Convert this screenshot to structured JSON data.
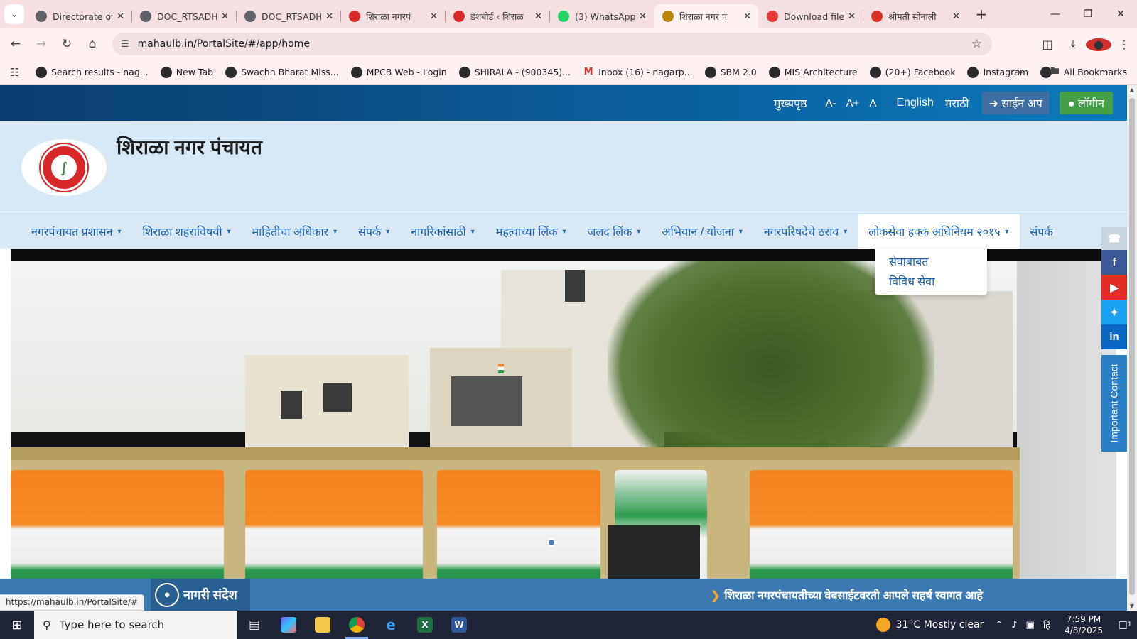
{
  "browser": {
    "tabs": [
      {
        "title": "Directorate of",
        "favicon_color": "#5f6368"
      },
      {
        "title": "DOC_RTSADHI",
        "favicon_color": "#5f6368"
      },
      {
        "title": "DOC_RTSADHI",
        "favicon_color": "#5f6368"
      },
      {
        "title": "शिराळा नगरपं",
        "favicon_color": "#d62828"
      },
      {
        "title": "डॅशबोर्ड ‹ शिराळ",
        "favicon_color": "#d62828"
      },
      {
        "title": "(3) WhatsApp",
        "favicon_color": "#25d366"
      },
      {
        "title": "शिराळा नगर पं",
        "favicon_color": "#b8860b"
      },
      {
        "title": "Download file",
        "favicon_color": "#e53935"
      },
      {
        "title": "श्रीमती सोनाली",
        "favicon_color": "#d93025"
      }
    ],
    "active_tab_index": 6,
    "url": "mahaulb.in/PortalSite/#/app/home",
    "bookmarks": [
      {
        "label": "Search results - nag..."
      },
      {
        "label": "New Tab"
      },
      {
        "label": "Swachh Bharat Miss..."
      },
      {
        "label": "MPCB Web - Login"
      },
      {
        "label": "SHIRALA - (900345)..."
      },
      {
        "label": "Inbox (16) - nagarp...",
        "icon": "gmail-icon"
      },
      {
        "label": "SBM 2.0"
      },
      {
        "label": "MIS Architecture"
      },
      {
        "label": "(20+) Facebook"
      },
      {
        "label": "Instagram"
      },
      {
        "label": ""
      }
    ],
    "all_bookmarks": "All Bookmarks",
    "status_url": "https://mahaulb.in/PortalSite/#"
  },
  "site": {
    "top_links": {
      "home": "मुख्यपृष्ठ",
      "font_minus": "A-",
      "font_plus": "A+",
      "font_reset": "A",
      "english": "English",
      "marathi": "मराठी",
      "signup": "साईन अप",
      "login": "लॉगीन"
    },
    "title": "शिराळा नगर पंचायत",
    "nav": [
      {
        "label": "नगरपंचायत प्रशासन",
        "caret": true
      },
      {
        "label": "शिराळा शहराविषयी",
        "caret": true
      },
      {
        "label": "माहितीचा अधिकार",
        "caret": true
      },
      {
        "label": "संपर्क",
        "caret": true
      },
      {
        "label": "नागरिकांसाठी",
        "caret": true
      },
      {
        "label": "महत्वाच्या लिंक",
        "caret": true
      },
      {
        "label": "जलद लिंक",
        "caret": true
      },
      {
        "label": "अभियान / योजना",
        "caret": true
      },
      {
        "label": "नगरपरिषदेचे ठराव",
        "caret": true
      },
      {
        "label": "लोकसेवा हक्क अधिनियम २०१५",
        "caret": true,
        "open": true
      },
      {
        "label": "संपर्क",
        "caret": false
      }
    ],
    "dropdown_items": [
      "सेवाबाबत",
      "विविध सेवा"
    ],
    "social": {
      "facebook": "f",
      "linkedin": "in"
    },
    "important_contact": "Important Contact",
    "ticker_label": "नागरी संदेश",
    "ticker_text": "शिराळा नगरपंचायतीच्या वेबसाईटवरती आपले सहर्ष स्वागत आहे"
  },
  "taskbar": {
    "search_placeholder": "Type here to search",
    "weather": "31°C  Mostly clear",
    "lang": "हिं",
    "time": "7:59 PM",
    "date": "4/8/2025",
    "notifications": "1"
  },
  "colors": {
    "topbar": "#0b5d9b",
    "brand_bg": "#d9e8f5",
    "nav_text": "#1a5fa5",
    "login_green": "#43a047",
    "ticker_bg": "#3b78b2"
  }
}
